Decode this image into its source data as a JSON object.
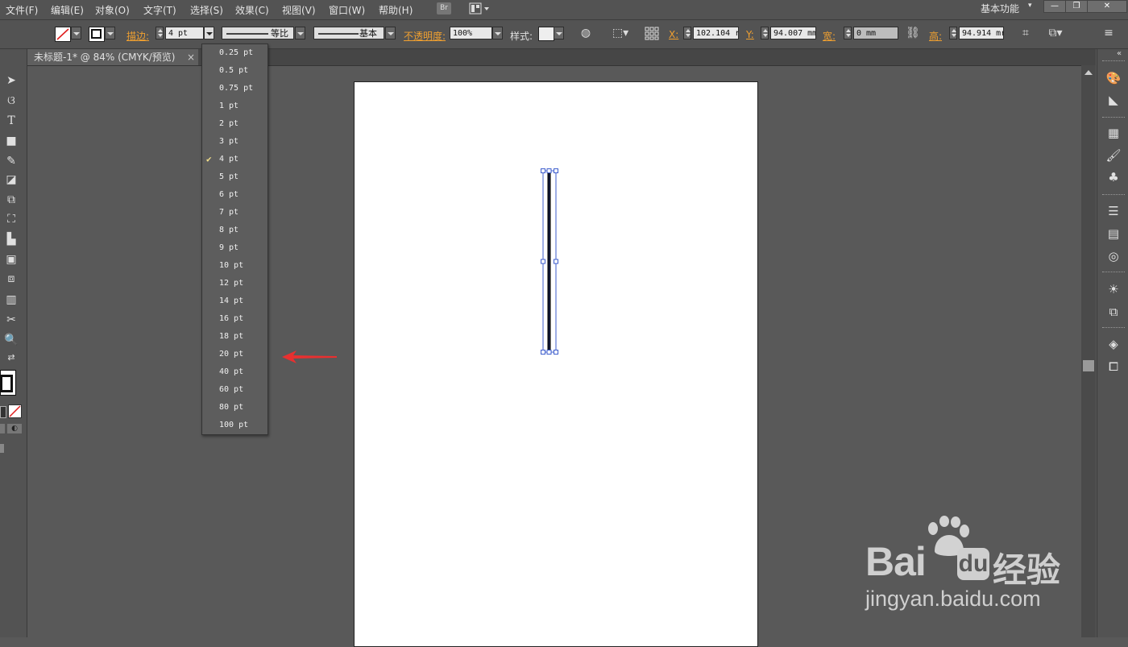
{
  "menu": {
    "items": [
      "文件(F)",
      "编辑(E)",
      "对象(O)",
      "文字(T)",
      "选择(S)",
      "效果(C)",
      "视图(V)",
      "窗口(W)",
      "帮助(H)"
    ],
    "bridge_label": "Br",
    "workspace": "基本功能"
  },
  "control_bar": {
    "stroke_label": "描边:",
    "stroke_weight": "4 pt",
    "profile_label": "等比",
    "brush_label": "基本",
    "opacity_label": "不透明度:",
    "opacity_value": "100%",
    "style_label": "样式:",
    "x_label": "X:",
    "x_value": "102.104 r",
    "y_label": "Y:",
    "y_value": "94.007 mm",
    "w_label": "宽:",
    "w_value": "0 mm",
    "h_label": "高:",
    "h_value": "94.914 mr"
  },
  "document_tab": {
    "title": "未标题-1* @ 84% (CMYK/预览)",
    "close": "×"
  },
  "stroke_dropdown": {
    "options": [
      "0.25 pt",
      "0.5 pt",
      "0.75 pt",
      "1 pt",
      "2 pt",
      "3 pt",
      "4 pt",
      "5 pt",
      "6 pt",
      "7 pt",
      "8 pt",
      "9 pt",
      "10 pt",
      "12 pt",
      "14 pt",
      "16 pt",
      "18 pt",
      "20 pt",
      "40 pt",
      "60 pt",
      "80 pt",
      "100 pt"
    ],
    "selected": "4 pt",
    "check": "✔"
  },
  "colors": {
    "accent_orange": "#f0a030",
    "arrow_red": "#e83030",
    "selection_blue": "#3c5ccc",
    "watermark_gray": "#c8c8c8"
  },
  "watermark": {
    "brand": "Bai",
    "brand_suffix": "经验",
    "url": "jingyan.baidu.com"
  }
}
